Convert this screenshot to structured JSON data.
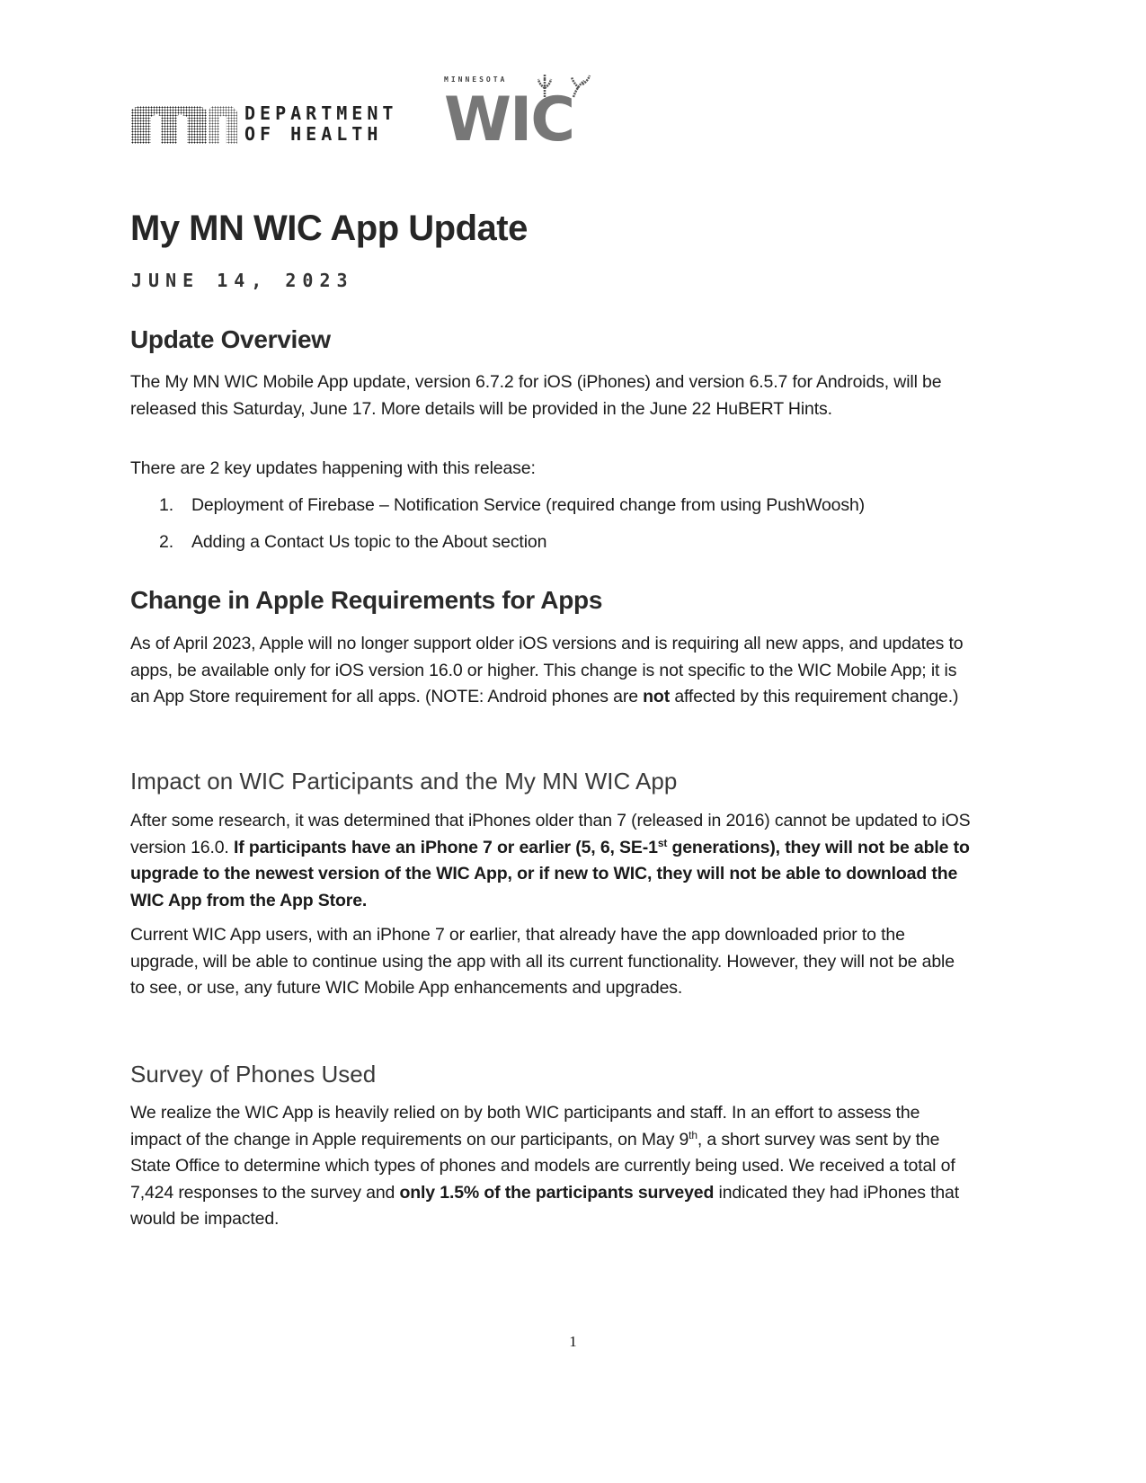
{
  "header": {
    "mdh_logo": {
      "mark_text": "mn",
      "line1": "DEPARTMENT",
      "line2": "OF HEALTH"
    },
    "wic_logo": {
      "state_text": "MINNESOTA",
      "wordmark": "WIC"
    }
  },
  "document": {
    "title": "My MN WIC App Update",
    "date": "JUNE 14, 2023",
    "sections": {
      "overview": {
        "heading": "Update Overview",
        "paragraph1": "The My MN WIC Mobile App update, version 6.7.2 for iOS (iPhones) and version 6.5.7 for Androids, will be released this Saturday, June 17. More details will be provided in the June 22 HuBERT Hints.",
        "paragraph2": "There are 2 key updates happening with this release:",
        "list": [
          {
            "number": "1.",
            "text": "Deployment of Firebase – Notification Service (required change from using PushWoosh)"
          },
          {
            "number": "2.",
            "text": "Adding a Contact Us topic to the About section"
          }
        ]
      },
      "apple_requirements": {
        "heading": "Change in Apple Requirements for Apps",
        "paragraph_pre": "As of April 2023, Apple will no longer support older iOS versions and is requiring all new apps, and updates to apps, be available only for iOS version 16.0 or higher. This change is not specific to the WIC Mobile App; it is an App Store requirement for all apps. (NOTE: Android phones are ",
        "paragraph_bold": "not",
        "paragraph_post": " affected by this requirement change.)"
      },
      "impact": {
        "heading": "Impact on WIC Participants and the My MN WIC App",
        "p1_pre": "After some research, it was determined that iPhones older than 7 (released in 2016) cannot be updated to iOS version 16.0. ",
        "p1_bold_a": "If participants have an iPhone 7 or earlier (5, 6, SE-1",
        "p1_bold_sup": "st",
        "p1_bold_b": " generations), they will not be able to upgrade to the newest version of the WIC App, or if new to WIC, they will not be able to download the WIC App from the App Store.",
        "p2": "Current WIC App users, with an iPhone 7 or earlier, that already have the app downloaded prior to the upgrade, will be able to continue using the app with all its current functionality. However, they will not be able to see, or use, any future WIC Mobile App enhancements and upgrades."
      },
      "survey": {
        "heading": "Survey of Phones Used",
        "p_pre": "We realize the WIC App is heavily relied on by both WIC participants and staff. In an effort to assess the impact of the change in Apple requirements on our participants, on May 9",
        "p_sup": "th",
        "p_mid": ", a short survey was sent by the State Office to determine which types of phones and models are currently being used. We received a total of 7,424 responses to the survey and ",
        "p_bold": "only 1.5% of the participants surveyed",
        "p_post": " indicated they had iPhones that would be impacted."
      }
    },
    "page_number": "1"
  }
}
